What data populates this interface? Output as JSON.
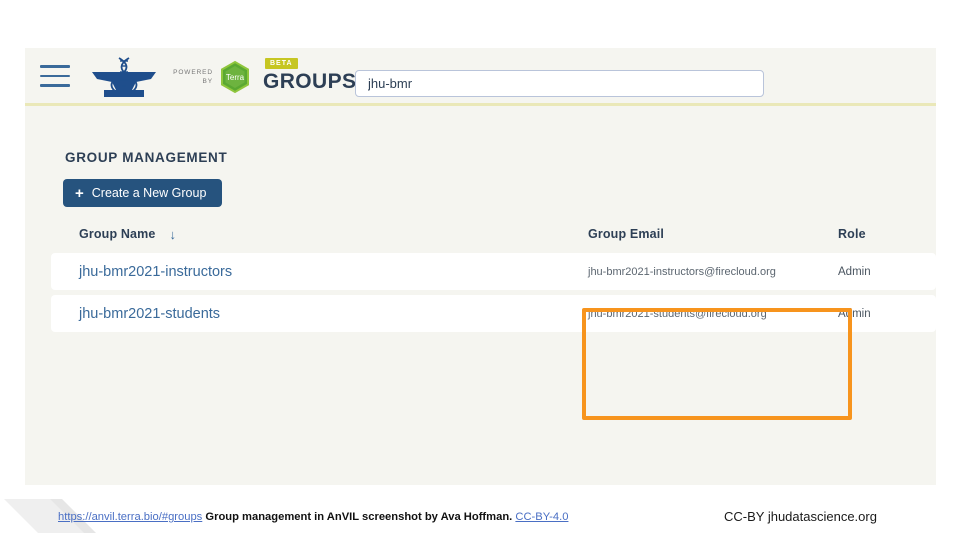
{
  "header": {
    "menu_icon": "hamburger-menu-icon",
    "logo_alt": "AnVIL anvil and DNA helix logo",
    "powered_by_line1": "POWERED",
    "powered_by_line2": "BY",
    "terra_label": "Terra",
    "beta_badge": "BETA",
    "product_name": "GROUPS",
    "divider_color": "#eae8b8"
  },
  "search": {
    "value": "jhu-bmr",
    "placeholder": ""
  },
  "main": {
    "page_title": "GROUP MANAGEMENT",
    "create_button": {
      "plus": "+",
      "label": "Create a New Group",
      "color": "#26537e"
    },
    "table": {
      "columns": [
        "Group Name",
        "Group Email",
        "Role"
      ],
      "sort_arrow": "↓",
      "sort_column": "Group Name",
      "rows": [
        {
          "name": "jhu-bmr2021-instructors",
          "email": "jhu-bmr2021-instructors@firecloud.org",
          "role": "Admin"
        },
        {
          "name": "jhu-bmr2021-students",
          "email": "jhu-bmr2021-students@firecloud.org",
          "role": "Admin"
        }
      ]
    }
  },
  "annotation": {
    "highlight_color": "#f7941d",
    "highlights_column": "Group Email"
  },
  "footer": {
    "url": "https://anvil.terra.bio/#groups",
    "caption": "Group management in AnVIL screenshot by Ava Hoffman.",
    "license_link": "CC-BY-4.0",
    "attribution": "CC-BY  jhudatascience.org"
  }
}
